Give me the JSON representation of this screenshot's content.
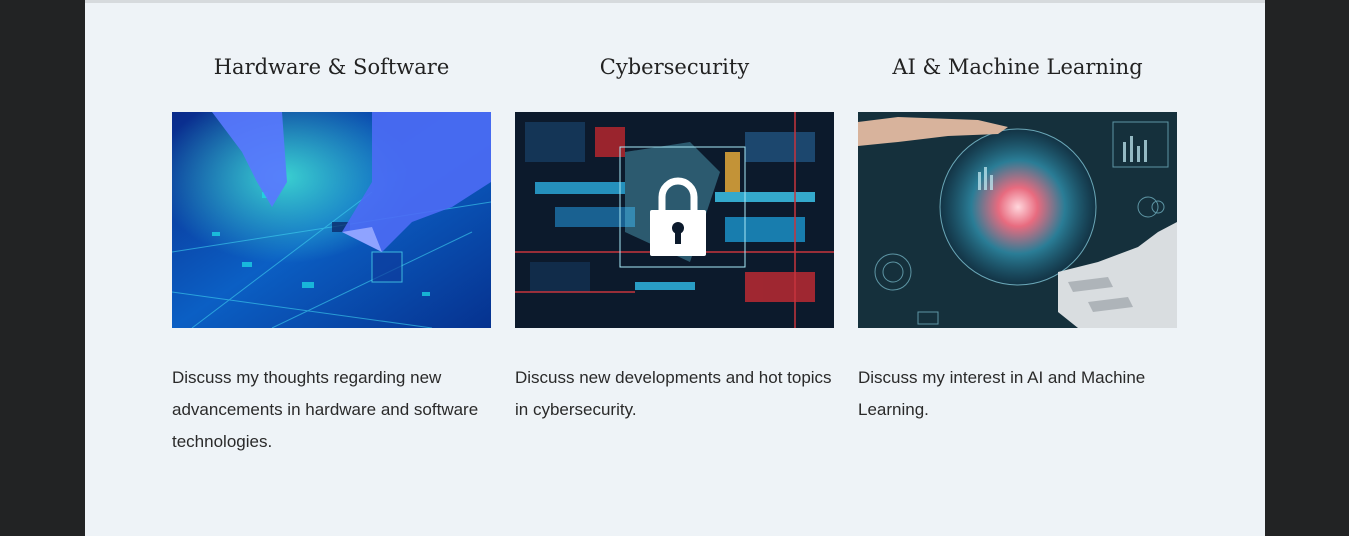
{
  "cards": [
    {
      "title": "Hardware & Software",
      "image": "circuit-board-gloves-image",
      "description": "Discuss my thoughts regarding new advancements in hardware and software technologies."
    },
    {
      "title": "Cybersecurity",
      "image": "padlock-circuit-image",
      "description": "Discuss new developments and hot topics in cybersecurity."
    },
    {
      "title": "AI & Machine Learning",
      "image": "robot-hand-globe-image",
      "description": "Discuss my interest in AI and Machine Learning."
    }
  ],
  "colors": {
    "outer_background": "#222324",
    "page_background": "#eef3f7",
    "text": "#2a2a2a"
  }
}
